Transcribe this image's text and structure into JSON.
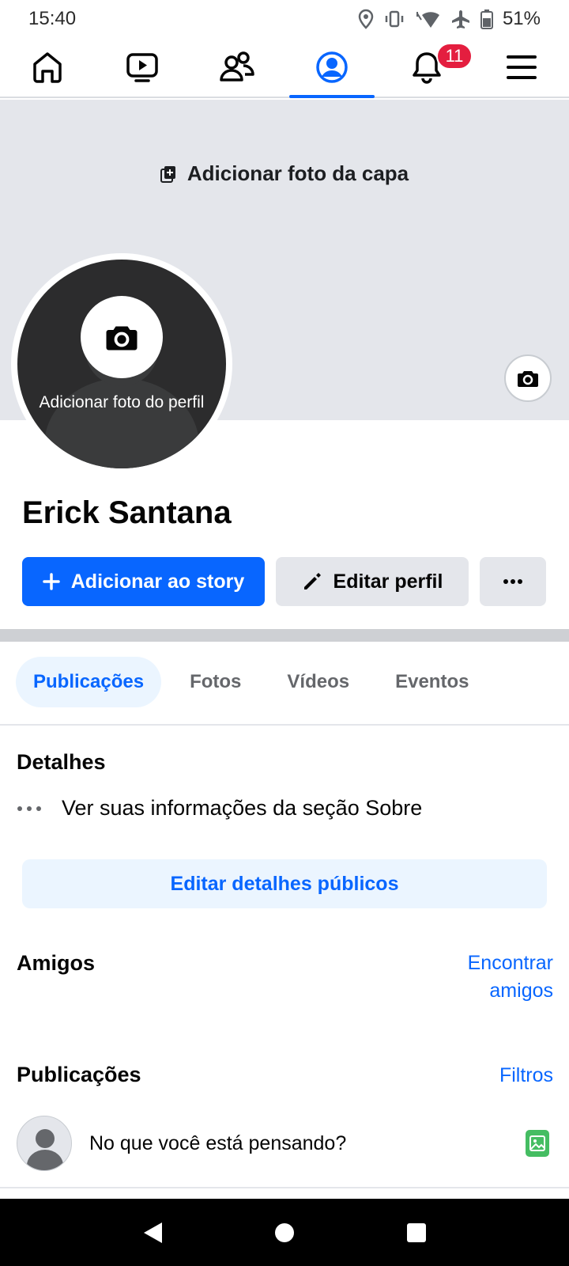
{
  "status_bar": {
    "time": "15:40",
    "battery": "51%"
  },
  "nav": {
    "tabs": [
      {
        "icon": "home-icon"
      },
      {
        "icon": "video-icon"
      },
      {
        "icon": "friends-icon"
      },
      {
        "icon": "profile-icon",
        "active": true
      },
      {
        "icon": "bell-icon",
        "badge": "11"
      },
      {
        "icon": "menu-icon"
      }
    ],
    "notifications_badge": "11"
  },
  "cover": {
    "add_cover_label": "Adicionar foto da capa"
  },
  "profile": {
    "add_photo_label": "Adicionar foto do perfil",
    "name": "Erick Santana"
  },
  "actions": {
    "add_story": "Adicionar ao story",
    "edit_profile": "Editar perfil"
  },
  "tabs": {
    "items": [
      "Publicações",
      "Fotos",
      "Vídeos",
      "Eventos"
    ],
    "active": "Publicações"
  },
  "details": {
    "title": "Detalhes",
    "about_link": "Ver suas informações da seção Sobre",
    "edit_button": "Editar detalhes públicos"
  },
  "friends": {
    "title": "Amigos",
    "find_line1": "Encontrar",
    "find_line2": "amigos"
  },
  "posts": {
    "title": "Publicações",
    "filters": "Filtros",
    "composer_prompt": "No que você está pensando?"
  },
  "colors": {
    "accent": "#0866ff",
    "badge": "#e41e3f",
    "photo_green": "#45bd62",
    "cover_bg": "#e4e6eb"
  }
}
